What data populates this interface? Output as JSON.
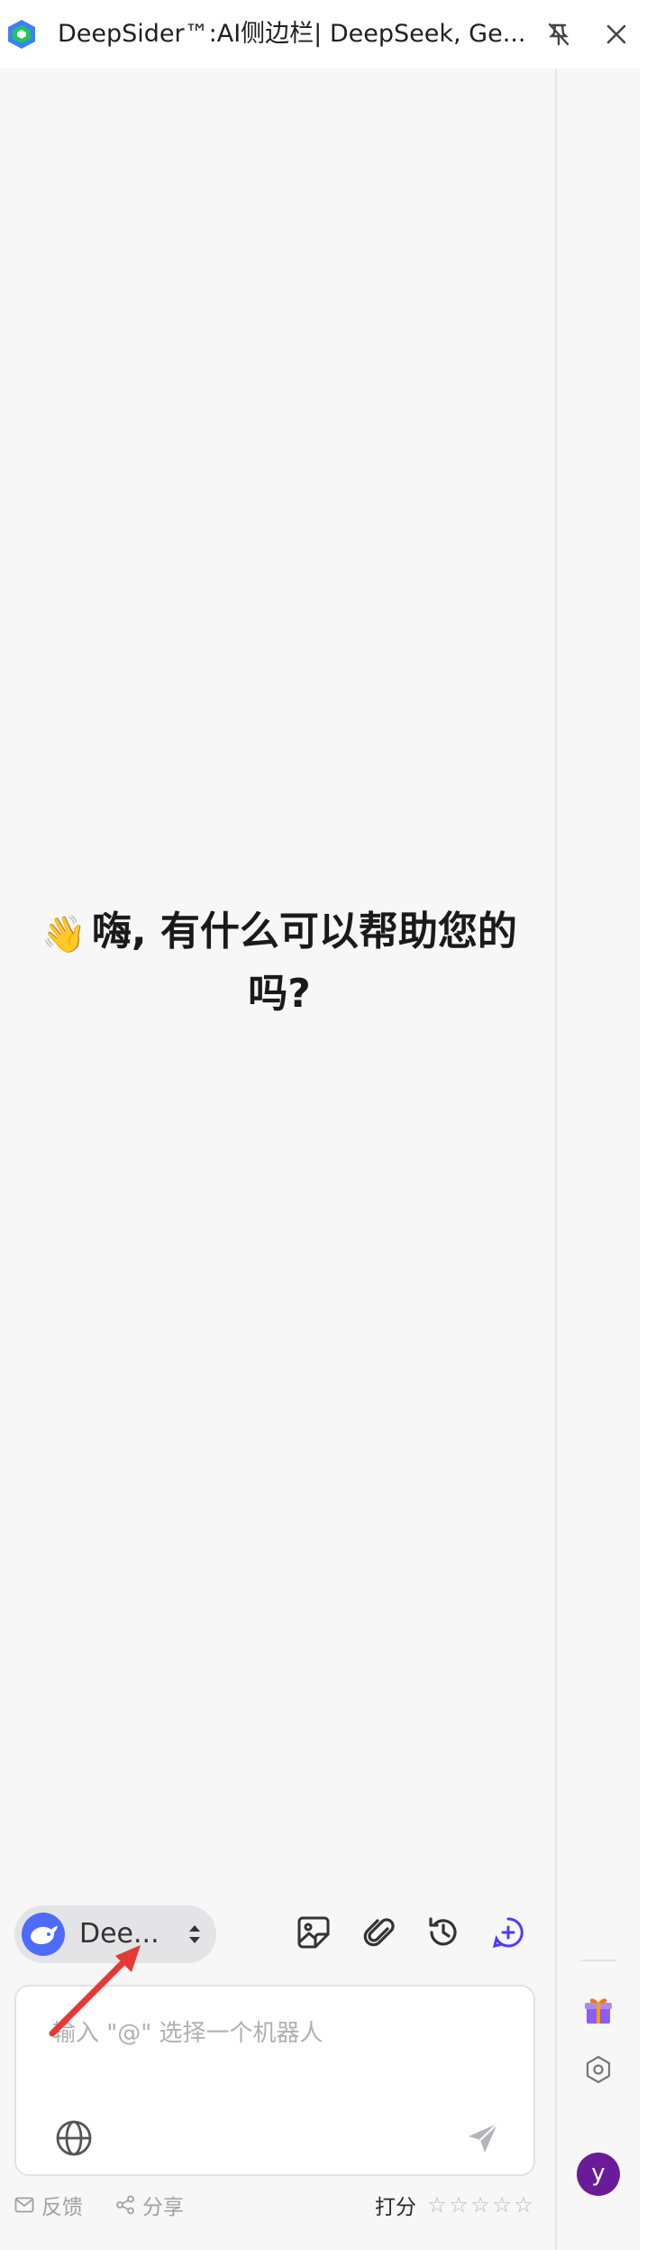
{
  "window": {
    "title": "DeepSider™:AI侧边栏| DeepSeek, Ge..."
  },
  "main": {
    "greeting_emoji": "👋",
    "greeting": "嗨, 有什么可以帮助您的吗?"
  },
  "toolbar": {
    "model_name": "Dee...",
    "icons": [
      "image-icon",
      "paperclip-icon",
      "history-icon",
      "new-chat-icon"
    ]
  },
  "input": {
    "placeholder": "输入 \"@\" 选择一个机器人"
  },
  "footer": {
    "feedback": "反馈",
    "share": "分享",
    "rating_label": "打分",
    "stars": [
      "☆",
      "☆",
      "☆",
      "☆",
      "☆"
    ]
  },
  "rail": {
    "user_initial": "y"
  },
  "colors": {
    "accent": "#4d6bfe",
    "avatar": "#6a1b9a",
    "arrow": "#e53935",
    "background": "#f7f7f7"
  }
}
